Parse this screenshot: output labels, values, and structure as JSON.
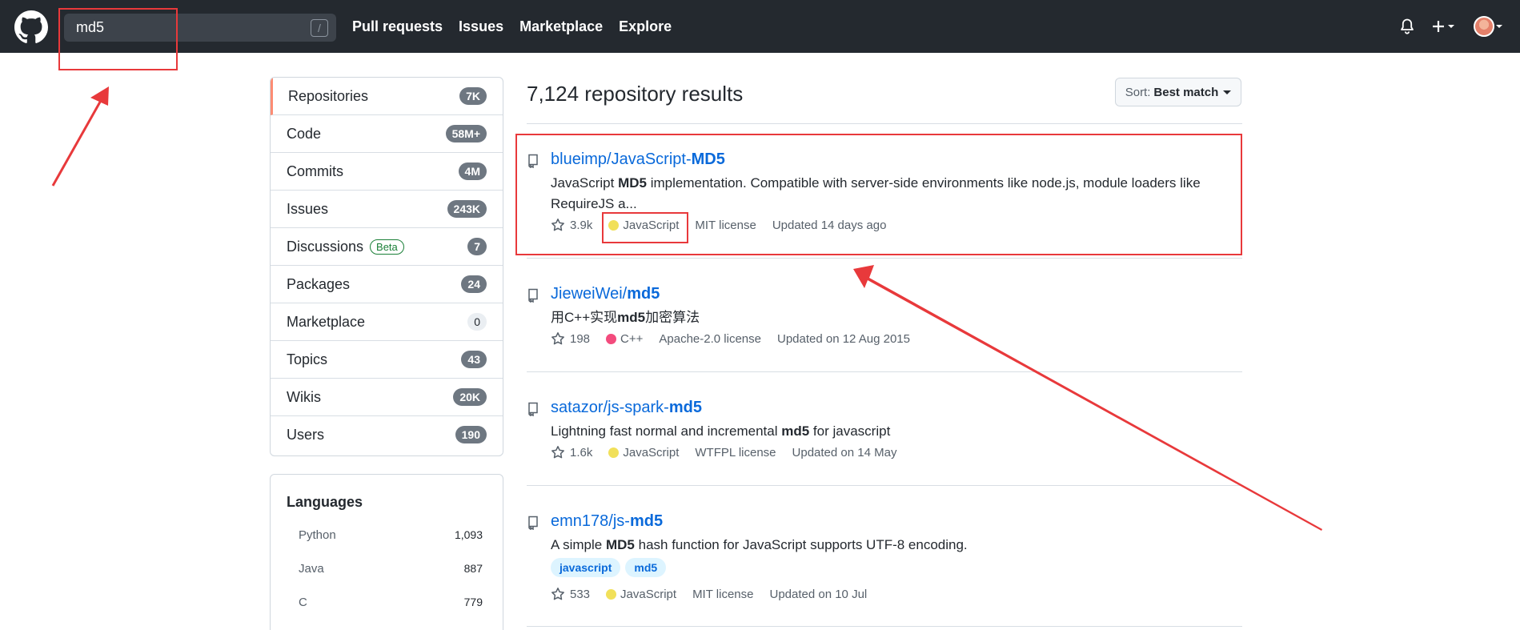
{
  "header": {
    "search_value": "md5",
    "slash_hint": "/",
    "nav": [
      "Pull requests",
      "Issues",
      "Marketplace",
      "Explore"
    ],
    "icons": [
      "bell-icon",
      "plus-icon",
      "avatar"
    ]
  },
  "sidebar": {
    "items": [
      {
        "label": "Repositories",
        "count": "7K",
        "selected": true
      },
      {
        "label": "Code",
        "count": "58M+"
      },
      {
        "label": "Commits",
        "count": "4M"
      },
      {
        "label": "Issues",
        "count": "243K"
      },
      {
        "label": "Discussions",
        "badge": "Beta",
        "count": "7"
      },
      {
        "label": "Packages",
        "count": "24"
      },
      {
        "label": "Marketplace",
        "count": "0"
      },
      {
        "label": "Topics",
        "count": "43"
      },
      {
        "label": "Wikis",
        "count": "20K"
      },
      {
        "label": "Users",
        "count": "190"
      }
    ]
  },
  "languages": {
    "title": "Languages",
    "items": [
      {
        "name": "Python",
        "count": "1,093"
      },
      {
        "name": "Java",
        "count": "887"
      },
      {
        "name": "C",
        "count": "779"
      }
    ]
  },
  "results": {
    "heading": "7,124 repository results",
    "sort_prefix": "Sort:",
    "sort_value": "Best match",
    "repos": [
      {
        "owner": "blueimp/JavaScript-",
        "name": "MD5",
        "desc_pre": "JavaScript ",
        "desc_bold": "MD5",
        "desc_post": " implementation. Compatible with server-side environments like node.js, module loaders like RequireJS a...",
        "stars": "3.9k",
        "language": "JavaScript",
        "lang_color": "#f1e05a",
        "license": "MIT license",
        "updated": "Updated 14 days ago"
      },
      {
        "owner": "JieweiWei/",
        "name": "md5",
        "desc_pre": "用C++实现",
        "desc_bold": "md5",
        "desc_post": "加密算法",
        "stars": "198",
        "language": "C++",
        "lang_color": "#f34b7d",
        "license": "Apache-2.0 license",
        "updated": "Updated on 12 Aug 2015"
      },
      {
        "owner": "satazor/js-spark-",
        "name": "md5",
        "desc_pre": "Lightning fast normal and incremental ",
        "desc_bold": "md5",
        "desc_post": " for javascript",
        "stars": "1.6k",
        "language": "JavaScript",
        "lang_color": "#f1e05a",
        "license": "WTFPL license",
        "updated": "Updated on 14 May"
      },
      {
        "owner": "emn178/js-",
        "name": "md5",
        "desc_pre": "A simple ",
        "desc_bold": "MD5",
        "desc_post": " hash function for JavaScript supports UTF-8 encoding.",
        "topics": [
          "javascript",
          "md5"
        ],
        "stars": "533",
        "language": "JavaScript",
        "lang_color": "#f1e05a",
        "license": "MIT license",
        "updated": "Updated on 10 Jul"
      }
    ]
  },
  "colors": {
    "header_bg": "#24292f",
    "link": "#0969da",
    "annotation": "#e8393b",
    "selected_accent": "#fd8c73"
  }
}
